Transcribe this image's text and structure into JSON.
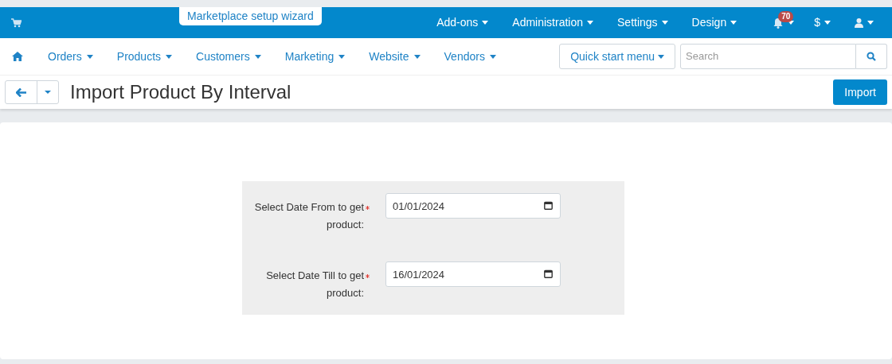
{
  "top_bar": {
    "wizard_tab": "Marketplace setup wizard",
    "menus": [
      "Add-ons",
      "Administration",
      "Settings",
      "Design"
    ],
    "notification_count": "70",
    "currency": "$"
  },
  "nav": {
    "items": [
      "Orders",
      "Products",
      "Customers",
      "Marketing",
      "Website",
      "Vendors"
    ],
    "quick_start": "Quick start menu",
    "search": {
      "placeholder": "Search"
    }
  },
  "page": {
    "title": "Import Product By Interval",
    "primary_button": "Import"
  },
  "form": {
    "fields": [
      {
        "label": "Select Date From to get",
        "label_end": "product:",
        "required": true,
        "value": "01/01/2024"
      },
      {
        "label": "Select Date Till to get",
        "label_end": "product:",
        "required": true,
        "value": "16/01/2024"
      }
    ]
  }
}
